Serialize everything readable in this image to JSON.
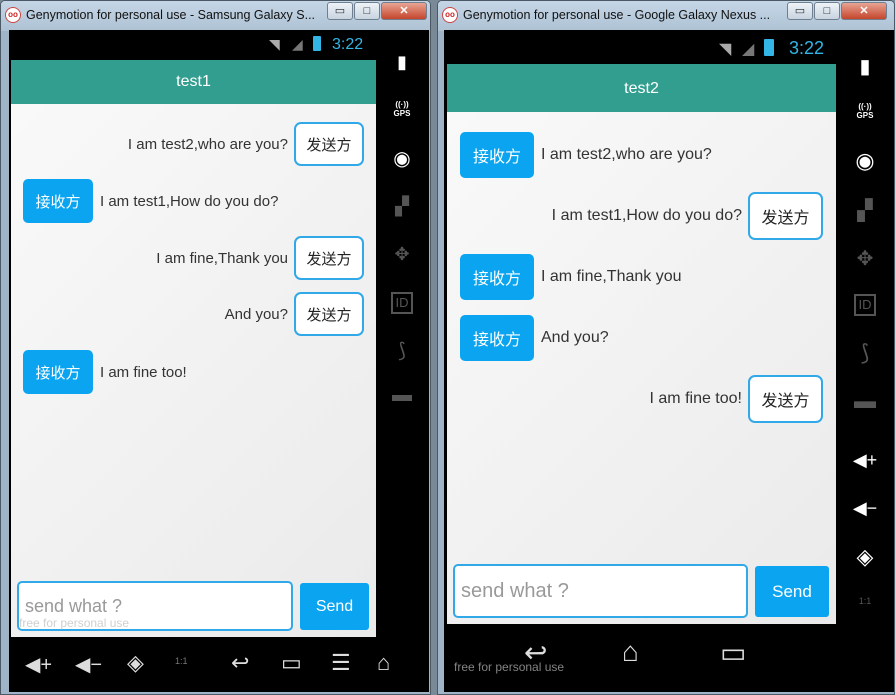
{
  "windows": [
    {
      "title": "Genymotion for personal use - Samsung Galaxy S...",
      "clock": "3:22",
      "app_title": "test1",
      "messages": [
        {
          "side": "right",
          "text": "I am test2,who are you?",
          "tag": "发送方"
        },
        {
          "side": "left",
          "text": "I am test1,How do you do?",
          "tag": "接收方"
        },
        {
          "side": "right",
          "text": "I am fine,Thank you",
          "tag": "发送方"
        },
        {
          "side": "right",
          "text": "And you?",
          "tag": "发送方"
        },
        {
          "side": "left",
          "text": "I am fine too!",
          "tag": "接收方"
        }
      ],
      "input_placeholder": "send what ?",
      "send_label": "Send",
      "watermark": "free for personal use"
    },
    {
      "title": "Genymotion for personal use - Google Galaxy Nexus ...",
      "clock": "3:22",
      "app_title": "test2",
      "messages": [
        {
          "side": "left",
          "text": "I am test2,who are you?",
          "tag": "接收方"
        },
        {
          "side": "right",
          "text": "I am test1,How do you do?",
          "tag": "发送方"
        },
        {
          "side": "left",
          "text": "I am fine,Thank you",
          "tag": "接收方"
        },
        {
          "side": "left",
          "text": "And you?",
          "tag": "接收方"
        },
        {
          "side": "right",
          "text": "I am fine too!",
          "tag": "发送方"
        }
      ],
      "input_placeholder": "send what ?",
      "send_label": "Send",
      "watermark": "free for personal use"
    }
  ],
  "side_labels": {
    "gps": "GPS",
    "id": "ID",
    "zoom": "1:1"
  },
  "window_buttons": {
    "minimize": "▭",
    "maximize": "□",
    "close": "✕"
  },
  "colors": {
    "action_bar": "#329e8f",
    "accent": "#0aa4f0",
    "border": "#31a8e8"
  }
}
